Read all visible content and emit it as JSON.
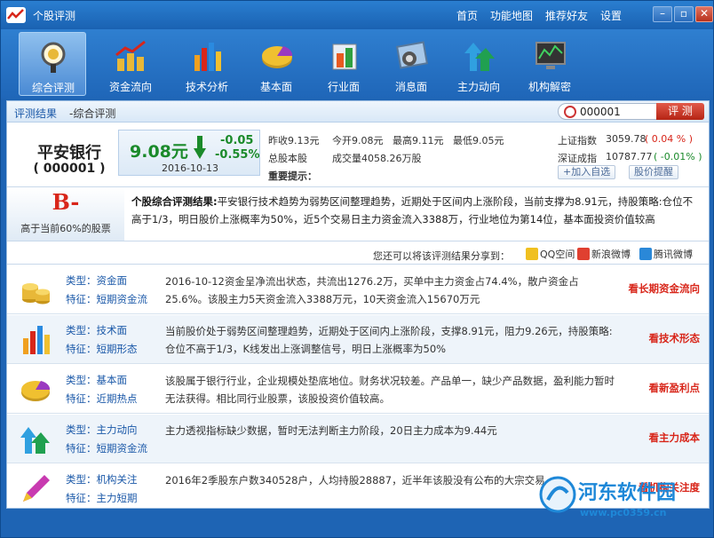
{
  "window": {
    "title": "个股评测",
    "nav": [
      "首页",
      "功能地图",
      "推荐好友",
      "设置"
    ],
    "min_label": "–",
    "max_label": "▫",
    "close_label": "✕"
  },
  "toolbar": [
    {
      "label": "综合评测",
      "icon": "magnifier-icon",
      "active": true
    },
    {
      "label": "资金流向",
      "icon": "coins-chart-icon",
      "active": false
    },
    {
      "label": "技术分析",
      "icon": "bar-chart-icon",
      "active": false
    },
    {
      "label": "基本面",
      "icon": "pie-icon",
      "active": false
    },
    {
      "label": "行业面",
      "icon": "cube-icon",
      "active": false
    },
    {
      "label": "消息面",
      "icon": "news-icon",
      "active": false
    },
    {
      "label": "主力动向",
      "icon": "arrows-icon",
      "active": false
    },
    {
      "label": "机构解密",
      "icon": "monitor-icon",
      "active": false
    }
  ],
  "breadcrumb": {
    "first": "评测结果",
    "second": "-综合评测"
  },
  "search": {
    "value": "000001",
    "button": "评 测"
  },
  "stock": {
    "name": "平安银行",
    "code": "( 000001 )",
    "price": "9.08元",
    "change": "-0.05",
    "change_pct": "-0.55%",
    "date": "2016-10-13",
    "prev_close": "昨收9.13元",
    "open": "今开9.08元",
    "high": "最高9.11元",
    "low": "最低9.05元",
    "total_shares": "总股本股",
    "volume": "成交量4058.26万股",
    "tip": "重要提示："
  },
  "indices": [
    {
      "name": "上证指数",
      "value": "3059.78",
      "change": "( 0.04 % )",
      "color": "#d8261a"
    },
    {
      "name": "深证成指",
      "value": "10787.77",
      "change": "( -0.01% )",
      "color": "#1a8a2a"
    }
  ],
  "actions": {
    "add_watch": "+加入自选",
    "price_alert": "股价提醒"
  },
  "result": {
    "grade": "B-",
    "grade_sub": "高于当前60%的股票",
    "title": "个股综合评测结果:",
    "text": "平安银行技术趋势为弱势区间整理趋势，近期处于区间内上涨阶段，当前支撑为8.91元，持股策略:仓位不高于1/3，明日股价上涨概率为50%，近5个交易日主力资金流入3388万，行业地位为第14位，基本面投资价值较高"
  },
  "share": {
    "text": "您还可以将该评测结果分享到：",
    "targets": [
      "QQ空间",
      "新浪微博",
      "腾讯微博"
    ]
  },
  "rows": [
    {
      "icon": "coins-icon",
      "type": "类型：资金面",
      "feature": "特征：短期资金流",
      "desc": "2016-10-12资金呈净流出状态，共流出1276.2万，买单中主力资金占74.4%，散户资金占25.6%。该股主力5天资金流入3388万元，10天资金流入15670万元",
      "action": "看长期资金流向"
    },
    {
      "icon": "bar-chart-icon",
      "type": "类型：技术面",
      "feature": "特征：短期形态",
      "desc": "当前股价处于弱势区间整理趋势，近期处于区间内上涨阶段，支撑8.91元，阻力9.26元，持股策略:仓位不高于1/3，K线发出上涨调整信号，明日上涨概率为50%",
      "action": "看技术形态"
    },
    {
      "icon": "pie-icon",
      "type": "类型：基本面",
      "feature": "特征：近期热点",
      "desc": "该股属于银行行业，企业规模处垫底地位。财务状况较差。产品单一，缺少产品数据，盈利能力暂时无法获得。相比同行业股票，该股投资价值较高。",
      "action": "看新盈利点"
    },
    {
      "icon": "arrows-icon",
      "type": "类型：主力动向",
      "feature": "特征：短期资金流",
      "desc": "主力透视指标缺少数据，暂时无法判断主力阶段，20日主力成本为9.44元",
      "action": "看主力成本"
    },
    {
      "icon": "pen-icon",
      "type": "类型：机构关注",
      "feature": "特征：主力短期",
      "desc": "2016年2季股东户数340528户，人均持股28887，近半年该股没有公布的大宗交易",
      "action": "看机构关注度"
    }
  ],
  "watermark": {
    "text": "河东软件园",
    "url": "www.pc0359.cn"
  }
}
